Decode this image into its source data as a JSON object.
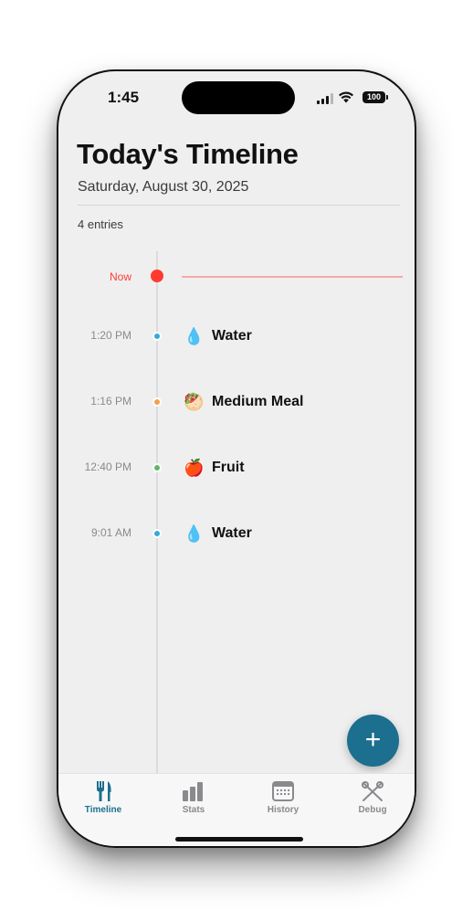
{
  "status_bar": {
    "time": "1:45",
    "battery": "100"
  },
  "header": {
    "title": "Today's Timeline",
    "date": "Saturday, August 30, 2025",
    "entry_count": "4 entries"
  },
  "timeline": {
    "now_label": "Now",
    "entries": [
      {
        "time": "1:20 PM",
        "icon": "💧",
        "icon_name": "water-drop-icon",
        "label": "Water",
        "dot_color": "#34aadc"
      },
      {
        "time": "1:16 PM",
        "icon": "🥙",
        "icon_name": "meal-icon",
        "label": "Medium Meal",
        "dot_color": "#f5a04a"
      },
      {
        "time": "12:40 PM",
        "icon": "🍎",
        "icon_name": "apple-icon",
        "label": "Fruit",
        "dot_color": "#62b56a"
      },
      {
        "time": "9:01 AM",
        "icon": "💧",
        "icon_name": "water-drop-icon",
        "label": "Water",
        "dot_color": "#34aadc"
      }
    ]
  },
  "fab": {
    "symbol": "+"
  },
  "tabs": [
    {
      "label": "Timeline",
      "icon": "fork-knife-icon",
      "active": true
    },
    {
      "label": "Stats",
      "icon": "bar-chart-icon",
      "active": false
    },
    {
      "label": "History",
      "icon": "calendar-icon",
      "active": false
    },
    {
      "label": "Debug",
      "icon": "tools-icon",
      "active": false
    }
  ],
  "colors": {
    "accent": "#1c6f8e",
    "now": "#ff3b30",
    "background": "#efeff0"
  }
}
